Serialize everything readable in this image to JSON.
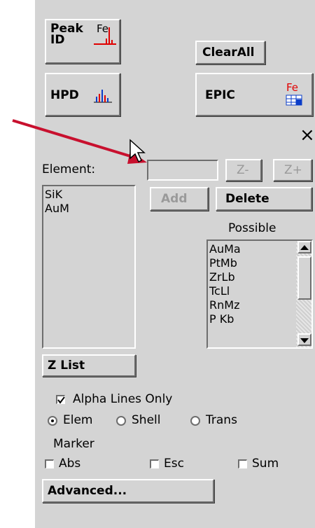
{
  "toolbar": {
    "peak_id_label": "Peak\nID",
    "peak_id_icon_text": "Fe",
    "clear_all_label": "ClearAll",
    "hpd_label": "HPD",
    "epic_label": "EPIC",
    "epic_icon_text": "Fe"
  },
  "close_glyph": "×",
  "element": {
    "label": "Element:",
    "input_value": "",
    "z_minus_label": "Z-",
    "z_plus_label": "Z+"
  },
  "selected_list": [
    "SiK",
    "AuM"
  ],
  "actions": {
    "add_label": "Add",
    "delete_label": "Delete"
  },
  "possible": {
    "label": "Possible",
    "items": [
      "AuMa",
      "PtMb",
      "ZrLb",
      "TcLl",
      "RnMz",
      "P Kb"
    ]
  },
  "zlist_label": "Z List",
  "options": {
    "alpha_lines_label": "Alpha Lines Only",
    "alpha_lines_checked": true,
    "mode_options": [
      "Elem",
      "Shell",
      "Trans"
    ],
    "mode_selected": "Elem"
  },
  "marker": {
    "label": "Marker",
    "abs_label": "Abs",
    "esc_label": "Esc",
    "sum_label": "Sum"
  },
  "advanced_label": "Advanced...",
  "colors": {
    "panel_bg": "#d4d4d4",
    "arrow": "#c8102e",
    "peak_icon": "#e00000",
    "epic_icon": "#0a3cc8"
  }
}
